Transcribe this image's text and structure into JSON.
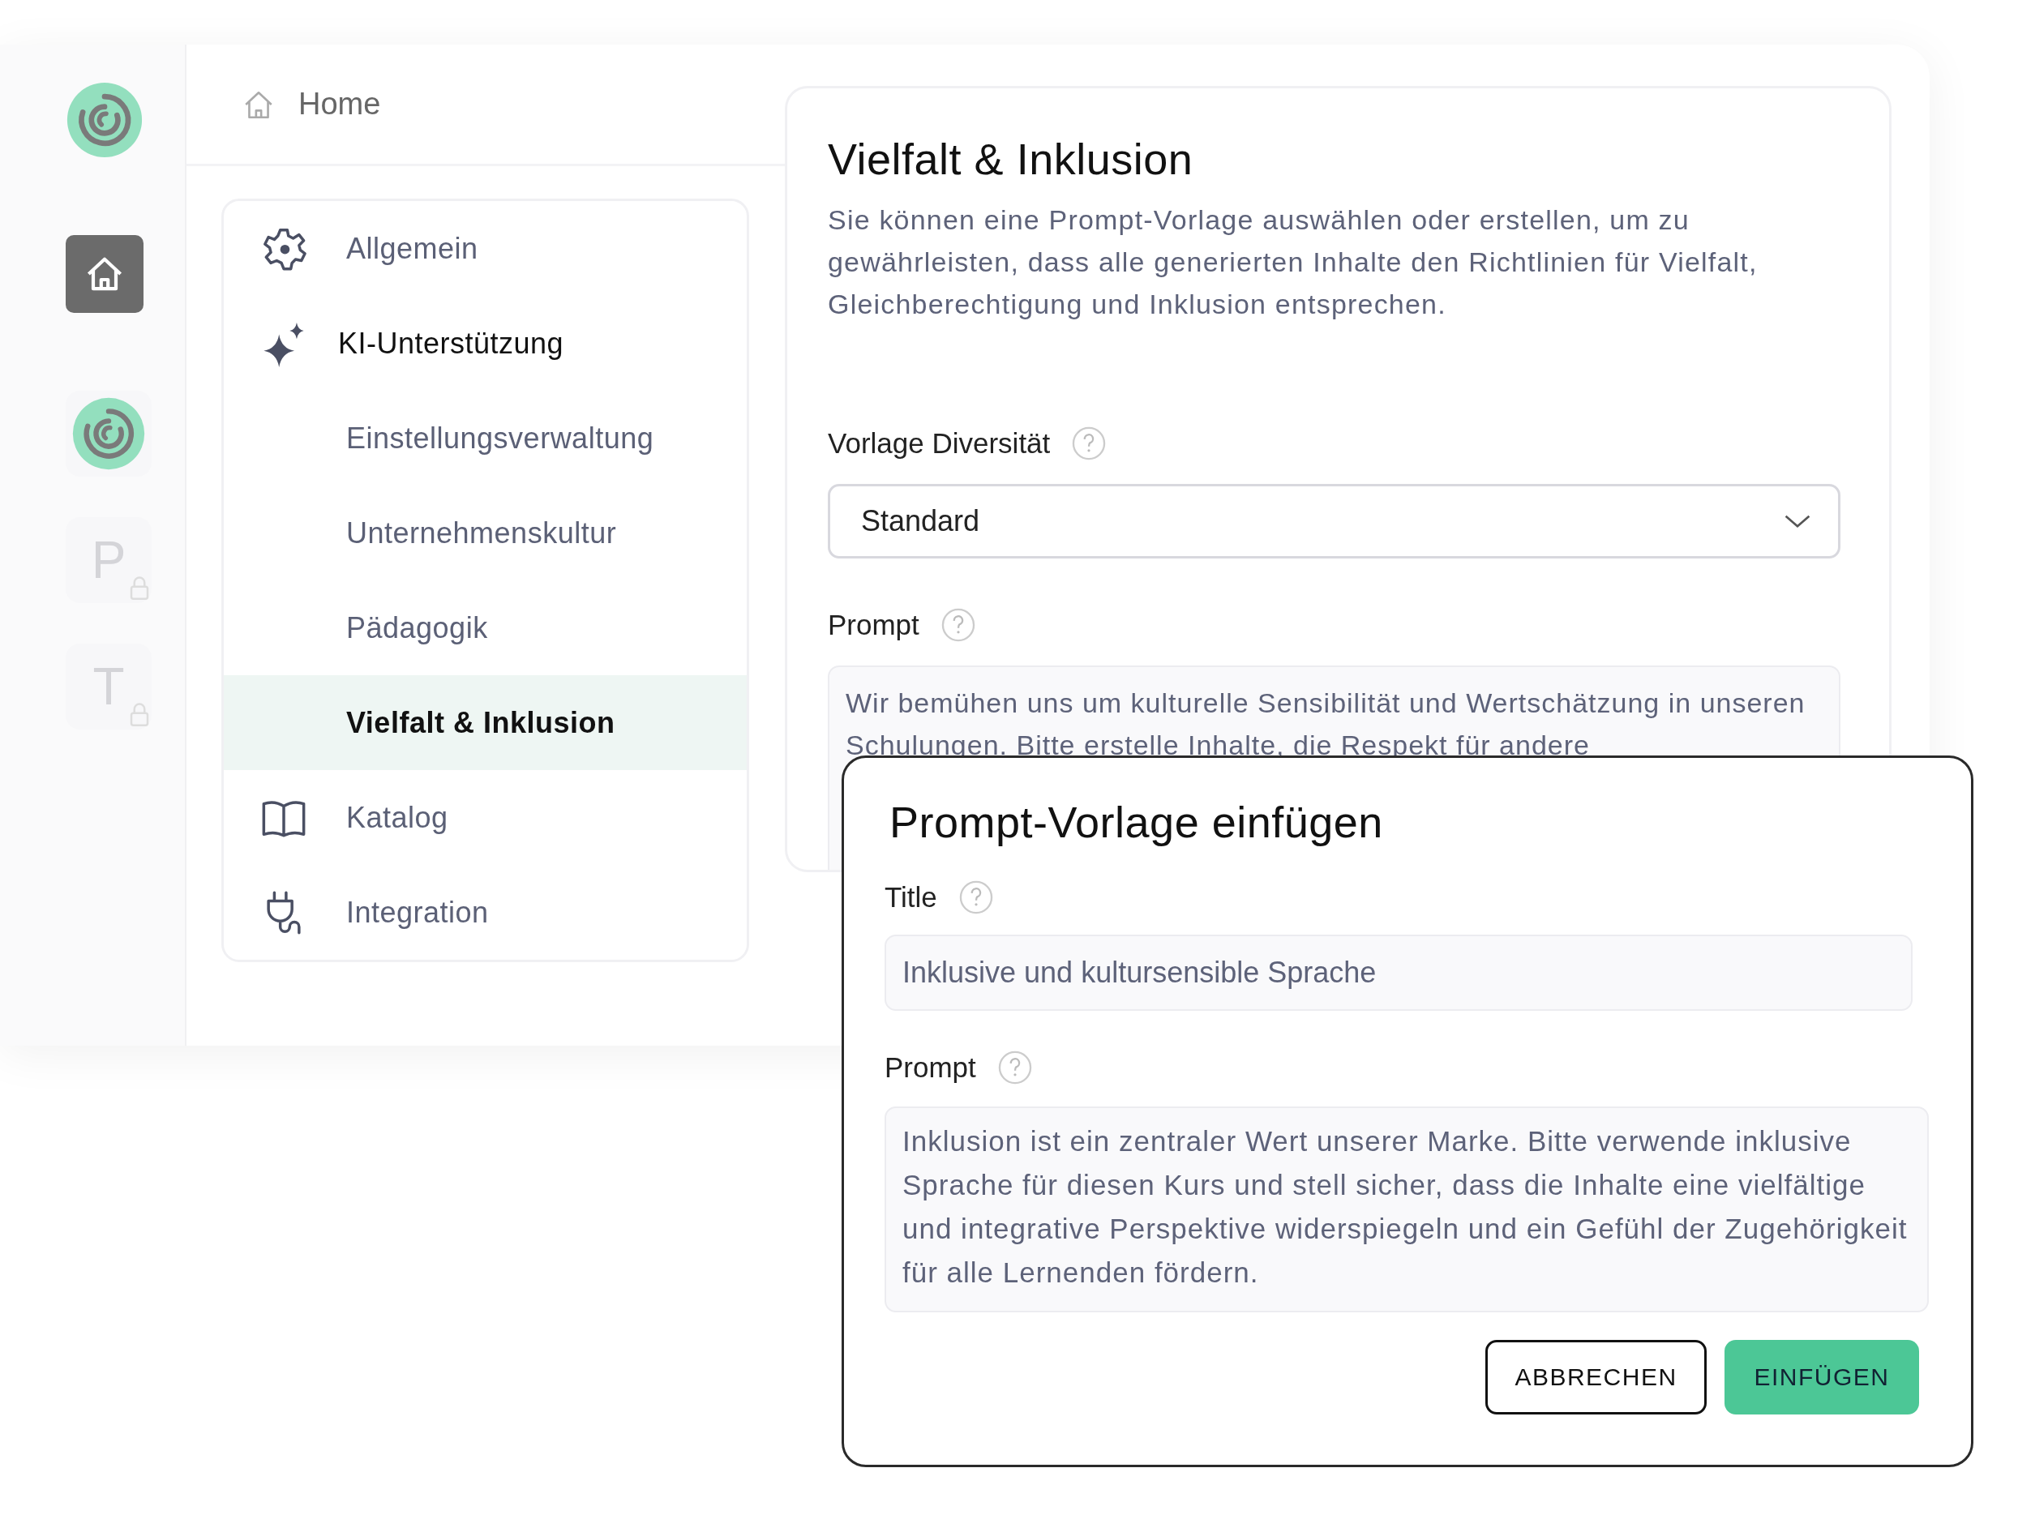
{
  "rail": [
    {
      "kind": "logo"
    },
    {
      "kind": "home",
      "selected": true
    },
    {
      "kind": "workspace",
      "selected": false
    },
    {
      "kind": "letter",
      "label": "P",
      "locked": true,
      "selected": false
    },
    {
      "kind": "letter",
      "label": "T",
      "locked": true,
      "selected": false
    }
  ],
  "breadcrumb": {
    "label": "Home"
  },
  "menu": {
    "items": [
      {
        "label": "Allgemein",
        "selected": false
      },
      {
        "label": "KI-Unterstützung",
        "selected": false,
        "expanded": true,
        "children": [
          {
            "label": "Einstellungsverwaltung",
            "selected": false
          },
          {
            "label": "Unternehmenskultur",
            "selected": false
          },
          {
            "label": "Pädagogik",
            "selected": false
          },
          {
            "label": "Vielfalt & Inklusion",
            "selected": true
          }
        ]
      },
      {
        "label": "Katalog",
        "selected": false
      },
      {
        "label": "Integration",
        "selected": false
      }
    ]
  },
  "content": {
    "title": "Vielfalt & Inklusion",
    "description": "Sie können eine Prompt-Vorlage auswählen oder erstellen, um zu gewährleisten, dass alle generierten Inhalte den Richtlinien für Vielfalt, Gleichberechtigung und Inklusion entsprechen.",
    "template_field": {
      "label": "Vorlage Diversität",
      "value": "Standard"
    },
    "prompt_field": {
      "label": "Prompt",
      "value": "Wir bemühen uns um kulturelle Sensibilität und Wertschätzung in unseren Schulungen. Bitte erstelle Inhalte, die Respekt für andere"
    }
  },
  "dialog": {
    "title": "Prompt-Vorlage einfügen",
    "title_field": {
      "label": "Title",
      "value": "Inklusive und kultursensible Sprache"
    },
    "prompt_field": {
      "label": "Prompt",
      "value": "Inklusion ist ein zentraler Wert unserer Marke. Bitte verwende inklusive Sprache für diesen Kurs und stell sicher, dass die Inhalte eine vielfältige und integrative Perspektive widerspiegeln und ein Gefühl der Zugehörigkeit für alle Lernenden fördern."
    },
    "buttons": [
      {
        "label": "ABBRECHEN",
        "kind": "secondary"
      },
      {
        "label": "EINFÜGEN",
        "kind": "primary"
      }
    ]
  }
}
